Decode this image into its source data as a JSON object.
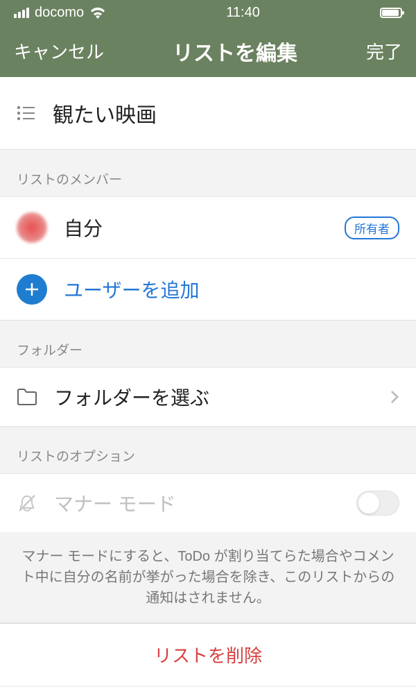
{
  "status": {
    "carrier": "docomo",
    "time": "11:40"
  },
  "nav": {
    "cancel": "キャンセル",
    "title": "リストを編集",
    "done": "完了"
  },
  "list": {
    "name": "観たい映画"
  },
  "sections": {
    "members": "リストのメンバー",
    "folder": "フォルダー",
    "options": "リストのオプション"
  },
  "members": {
    "self": "自分",
    "owner_badge": "所有者",
    "add_user": "ユーザーを追加"
  },
  "folder": {
    "select": "フォルダーを選ぶ"
  },
  "options": {
    "mute": "マナー モード",
    "mute_description": "マナー モードにすると、ToDo が割り当てらた場合やコメント中に自分の名前が挙がった場合を除き、このリストからの通知はされません。"
  },
  "delete": {
    "label": "リストを削除"
  }
}
